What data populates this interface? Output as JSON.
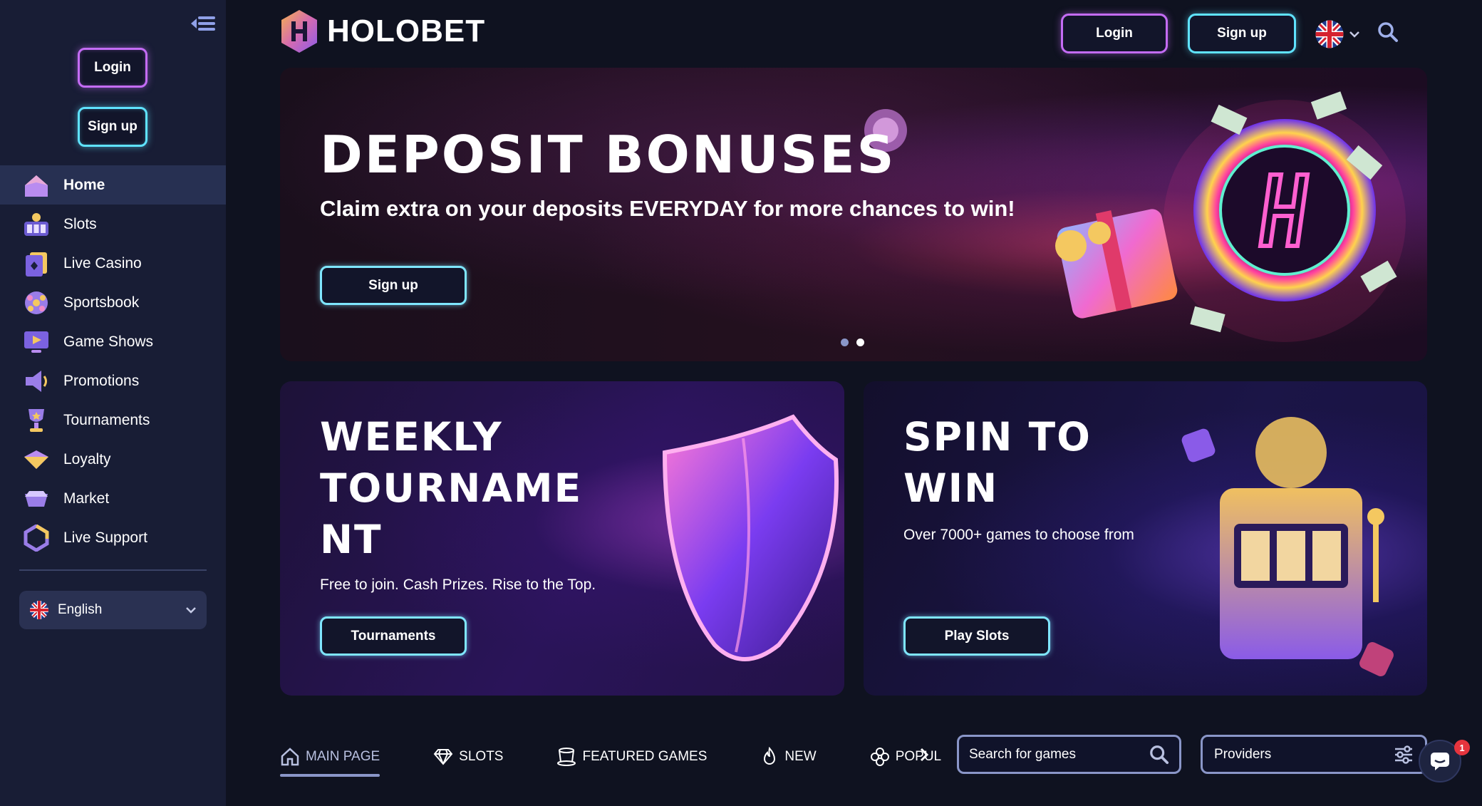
{
  "brand": {
    "name": "HOLOBET"
  },
  "sidebar": {
    "login_label": "Login",
    "signup_label": "Sign up",
    "items": [
      {
        "label": "Home",
        "icon": "home-icon",
        "active": true
      },
      {
        "label": "Slots",
        "icon": "slots-icon"
      },
      {
        "label": "Live Casino",
        "icon": "live-casino-icon"
      },
      {
        "label": "Sportsbook",
        "icon": "sportsbook-icon"
      },
      {
        "label": "Game Shows",
        "icon": "game-shows-icon"
      },
      {
        "label": "Promotions",
        "icon": "megaphone-icon"
      },
      {
        "label": "Tournaments",
        "icon": "trophy-icon"
      },
      {
        "label": "Loyalty",
        "icon": "loyalty-icon"
      },
      {
        "label": "Market",
        "icon": "market-icon"
      },
      {
        "label": "Live Support",
        "icon": "support-icon"
      }
    ],
    "language": "English"
  },
  "header": {
    "login_label": "Login",
    "signup_label": "Sign up",
    "language_icon": "uk-flag-icon"
  },
  "hero": {
    "title": "DEPOSIT BONUSES",
    "subtitle": "Claim extra on your deposits EVERYDAY for more chances to win!",
    "cta_label": "Sign up",
    "slides_total": 2,
    "active_slide": 2
  },
  "cards": {
    "tournament": {
      "title": "WEEKLY TOURNAME NT",
      "description": "Free to join. Cash Prizes. Rise to the Top.",
      "button_label": "Tournaments"
    },
    "spin": {
      "title": "SPIN TO WIN",
      "description": "Over 7000+ games to choose from",
      "button_label": "Play Slots"
    }
  },
  "tabs": [
    {
      "label": "MAIN PAGE",
      "icon": "home-outline-icon",
      "active": true
    },
    {
      "label": "SLOTS",
      "icon": "diamond-icon"
    },
    {
      "label": "FEATURED GAMES",
      "icon": "top-hat-icon"
    },
    {
      "label": "NEW",
      "icon": "flame-icon"
    },
    {
      "label": "POPUL",
      "icon": "clover-icon"
    }
  ],
  "search": {
    "placeholder": "Search for games"
  },
  "providers": {
    "label": "Providers"
  },
  "chat": {
    "badge_count": "1"
  },
  "colors": {
    "background": "#0f1220",
    "sidebar": "#181d35",
    "active_nav": "#273052",
    "accent_purple": "#c46cf5",
    "accent_cyan": "#5fe3ff"
  }
}
